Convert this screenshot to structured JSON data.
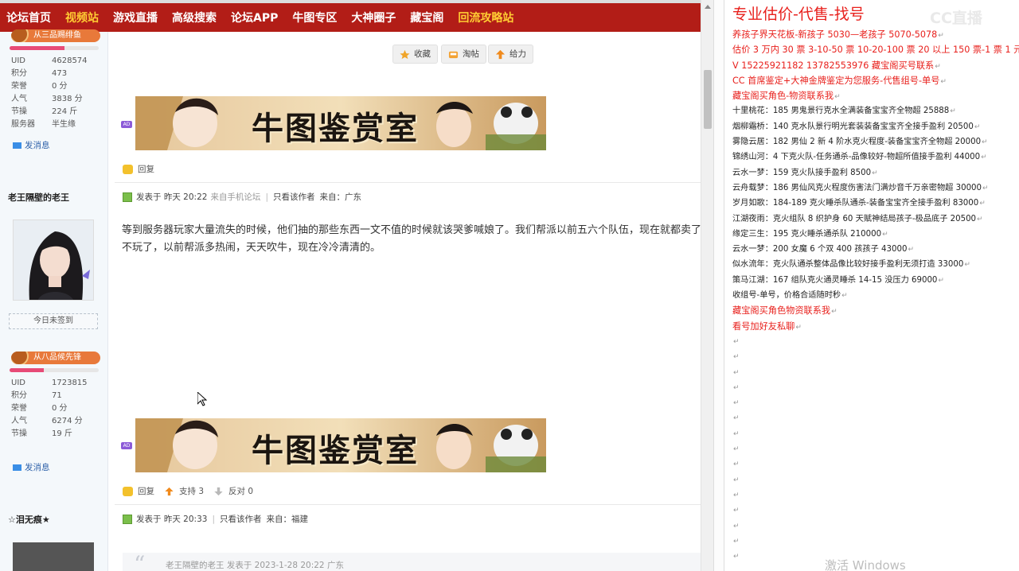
{
  "nav": {
    "items": [
      {
        "label": "论坛首页",
        "hl": false
      },
      {
        "label": "视频站",
        "hl": true
      },
      {
        "label": "游戏直播",
        "hl": false
      },
      {
        "label": "高级搜索",
        "hl": false
      },
      {
        "label": "论坛APP",
        "hl": false
      },
      {
        "label": "牛图专区",
        "hl": false
      },
      {
        "label": "大神圈子",
        "hl": false
      },
      {
        "label": "藏宝阁",
        "hl": false
      },
      {
        "label": "回流攻略站",
        "hl": true
      }
    ]
  },
  "user1": {
    "rank": "从三品赐绯鱼",
    "rank_progress": 0.62,
    "stats": [
      {
        "k": "UID",
        "v": "4628574"
      },
      {
        "k": "积分",
        "v": "473"
      },
      {
        "k": "荣誉",
        "v": "0 分"
      },
      {
        "k": "人气",
        "v": "3838 分"
      },
      {
        "k": "节操",
        "v": "224 斤"
      },
      {
        "k": "服务器",
        "v": "半生缘"
      }
    ],
    "pm": "发消息"
  },
  "user2": {
    "name": "老王隔壁的老王",
    "signin": "今日未签到",
    "rank": "从八品候先锋",
    "rank_progress": 0.38,
    "stats": [
      {
        "k": "UID",
        "v": "1723815"
      },
      {
        "k": "积分",
        "v": "71"
      },
      {
        "k": "荣誉",
        "v": "0 分"
      },
      {
        "k": "人气",
        "v": "6274 分"
      },
      {
        "k": "节操",
        "v": "19 斤"
      }
    ],
    "pm": "发消息"
  },
  "user3": {
    "name": "☆泪无痕★"
  },
  "top_actions": {
    "fav": "收藏",
    "tao": "淘帖",
    "give": "给力"
  },
  "banner": {
    "text": "牛图鉴赏室",
    "ad": "AD"
  },
  "post1": {
    "reply": "回复"
  },
  "post2": {
    "meta_posted": "发表于 昨天 20:22",
    "meta_mobile": "来自手机论坛",
    "meta_only": "只看该作者",
    "meta_from": "来自：广东",
    "body": "等到服务器玩家大量流失的时候，他们抽的那些东西一文不值的时候就该哭爹喊娘了。我们帮派以前五六个队伍，现在就都卖了不玩了，以前帮派多热闹，天天吹牛，现在冷冷清清的。",
    "reply": "回复",
    "support": "支持 3",
    "oppose": "反对 0"
  },
  "post3": {
    "meta_posted": "发表于 昨天 20:33",
    "meta_only": "只看该作者",
    "meta_from": "来自：福建",
    "quote": "老王隔壁的老王 发表于 2023-1-28 20:22 广东"
  },
  "notepad": {
    "title": "专业估价-代售-找号",
    "watermark": "CC直播",
    "lines": [
      {
        "t": "养孩子界天花板-新孩子 5030—老孩子 5070-5078",
        "red": true
      },
      {
        "t": "估价 3 万内 30 票 3-10-50 票 10-20-100 票 20 以上 150 票-1 票 1 元",
        "red": true
      },
      {
        "t": "V 15225921182     13782553976    藏宝阁买号联系",
        "red": true
      },
      {
        "t": "CC 首席鉴定+大神金牌鉴定为您服务-代售组号-单号",
        "red": true
      },
      {
        "t": "藏宝阁买角色-物资联系我",
        "red": true
      },
      {
        "t": "十里桃花：185 男鬼景行克水全满装备宝宝齐全物超 25888",
        "red": false
      },
      {
        "t": "烟柳霜桥：140 克水队景行明光套装装备宝宝齐全接手盈利 20500",
        "red": false
      },
      {
        "t": "雾隐云居：182 男仙 2 新 4 阶水克火程度-装备宝宝齐全物超 20000",
        "red": false
      },
      {
        "t": "锦绣山河：4 下克火队-任务通杀-品像较好-物超所值接手盈利 44000",
        "red": false
      },
      {
        "t": "云水一梦：159 克火队接手盈利 8500",
        "red": false
      },
      {
        "t": "云舟载梦：186 男仙风克火程度伤害法门满炒音千万亲密物超 30000",
        "red": false
      },
      {
        "t": "岁月如歌：184-189 克火睡杀队通杀-装备宝宝齐全接手盈利 83000",
        "red": false
      },
      {
        "t": "江湖夜雨：克火组队 8 织护身 60 天赋神结局孩子-极品底子 20500",
        "red": false
      },
      {
        "t": "缘定三生：195 克火睡杀通杀队 210000",
        "red": false
      },
      {
        "t": "云水一梦：200 女魔 6 个双 400 孩孩子 43000",
        "red": false
      },
      {
        "t": "似水流年：克火队通杀整体品像比较好接手盈利无须打造 33000",
        "red": false
      },
      {
        "t": "策马江湖：167 组队克火通灵睡杀 14-15 没压力 69000",
        "red": false
      },
      {
        "t": "收组号-单号，价格合适随时秒",
        "red": false
      },
      {
        "t": "藏宝阁买角色物资联系我",
        "red": true
      },
      {
        "t": "看号加好友私聊",
        "red": true
      }
    ],
    "empty_lines": 15,
    "windows_wm": "激活 Windows"
  },
  "colors": {
    "nav_bg": "#b21d17",
    "nav_hl": "#ffcc33",
    "note_red": "#e8201c"
  }
}
